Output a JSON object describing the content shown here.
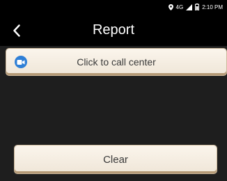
{
  "status_bar": {
    "network": "4G",
    "time": "2:10 PM",
    "icons": [
      "location-icon",
      "signal-icon",
      "battery-icon"
    ]
  },
  "header": {
    "back_icon": "back-icon",
    "title": "Report"
  },
  "actions": {
    "call_icon": "video-call-icon",
    "call_label": "Click to call center",
    "clear_label": "Clear"
  },
  "colors": {
    "background": "#1e1e1e",
    "bar": "#000000",
    "button_face": "#f5ede1",
    "button_shadow": "#b59a76",
    "call_icon": "#2f7fd6",
    "text_light": "#ffffff",
    "text_dark": "#3a3a3a"
  }
}
